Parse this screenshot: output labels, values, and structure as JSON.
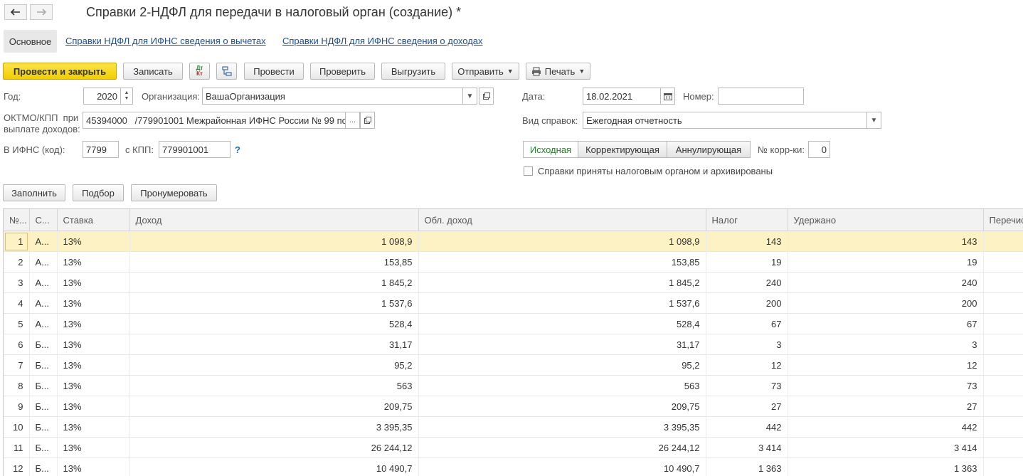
{
  "window": {
    "title": "Справки 2-НДФЛ для передачи в налоговый орган (создание) *",
    "back_icon": "arrow-left-icon",
    "forward_icon": "arrow-right-icon"
  },
  "nav": {
    "main_tab": "Основное",
    "links": [
      "Справки НДФЛ для ИФНС сведения о вычетах",
      "Справки НДФЛ для ИФНС сведения о доходах"
    ]
  },
  "toolbar": {
    "post_close": "Провести и закрыть",
    "save": "Записать",
    "dt_kt_icon_top": "Дт",
    "dt_kt_icon_bottom": "Кт",
    "post": "Провести",
    "check": "Проверить",
    "export": "Выгрузить",
    "send": "Отправить",
    "print": "Печать"
  },
  "form": {
    "year_label": "Год:",
    "year_value": "2020",
    "org_label": "Организация:",
    "org_value": "ВашаОрганизация",
    "date_label": "Дата:",
    "date_value": "18.02.2021",
    "number_label": "Номер:",
    "number_value": "",
    "oktmo_label_1": "ОКТМО/КПП  при",
    "oktmo_label_2": "выплате доходов:",
    "oktmo_value": "45394000   /779901001 Межрайонная ИФНС России № 99 по",
    "type_label": "Вид справок:",
    "type_value": "Ежегодная отчетность",
    "ifns_label": "В ИФНС (код):",
    "ifns_value": "7799",
    "kpp_label": "с КПП:",
    "kpp_value": "779901001",
    "help": "?",
    "segments": [
      "Исходная",
      "Корректирующая",
      "Аннулирующая"
    ],
    "corr_label": "№ корр-ки:",
    "corr_value": "0",
    "archived_label": "Справки приняты налоговым органом и архивированы",
    "archived_checked": false
  },
  "table_toolbar": {
    "fill": "Заполнить",
    "select": "Подбор",
    "renumber": "Пронумеровать"
  },
  "table": {
    "columns": [
      "№...",
      "С...",
      "Ставка",
      "Доход",
      "Обл. доход",
      "Налог",
      "Удержано",
      "Перечис"
    ],
    "rows": [
      [
        "1",
        "А...",
        "13%",
        "1 098,9",
        "1 098,9",
        "143",
        "143",
        ""
      ],
      [
        "2",
        "А...",
        "13%",
        "153,85",
        "153,85",
        "19",
        "19",
        ""
      ],
      [
        "3",
        "А...",
        "13%",
        "1 845,2",
        "1 845,2",
        "240",
        "240",
        ""
      ],
      [
        "4",
        "А...",
        "13%",
        "1 537,6",
        "1 537,6",
        "200",
        "200",
        ""
      ],
      [
        "5",
        "А...",
        "13%",
        "528,4",
        "528,4",
        "67",
        "67",
        ""
      ],
      [
        "6",
        "Б...",
        "13%",
        "31,17",
        "31,17",
        "3",
        "3",
        ""
      ],
      [
        "7",
        "Б...",
        "13%",
        "95,2",
        "95,2",
        "12",
        "12",
        ""
      ],
      [
        "8",
        "Б...",
        "13%",
        "563",
        "563",
        "73",
        "73",
        ""
      ],
      [
        "9",
        "Б...",
        "13%",
        "209,75",
        "209,75",
        "27",
        "27",
        ""
      ],
      [
        "10",
        "Б...",
        "13%",
        "3 395,35",
        "3 395,35",
        "442",
        "442",
        ""
      ],
      [
        "11",
        "Б...",
        "13%",
        "26 244,12",
        "26 244,12",
        "3 414",
        "3 414",
        ""
      ],
      [
        "12",
        "Б...",
        "13%",
        "10 490,7",
        "10 490,7",
        "1 363",
        "1 363",
        ""
      ]
    ]
  },
  "colors": {
    "accent_yellow": "#f6d611",
    "selected_row": "#fcf2c4",
    "link": "#1c4f8f",
    "active_segment_text": "#2a7a2a"
  }
}
